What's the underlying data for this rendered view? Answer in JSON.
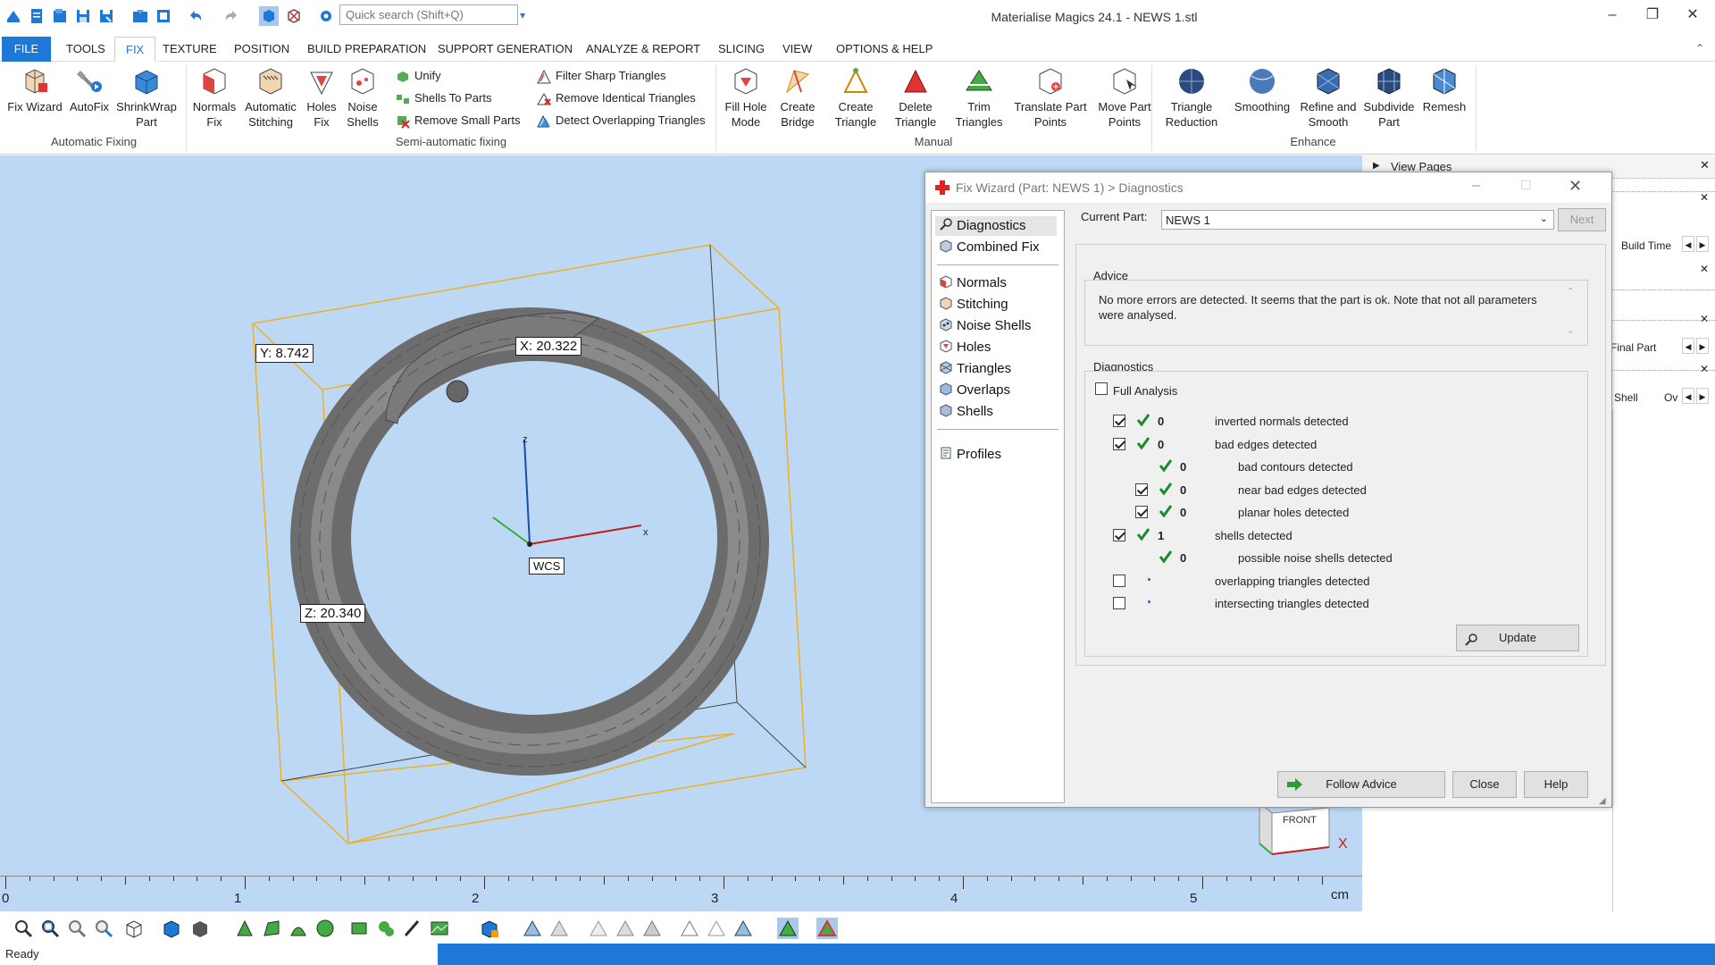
{
  "app": {
    "title": "Materialise Magics 24.1 - NEWS 1.stl",
    "search_placeholder": "Quick search (Shift+Q)"
  },
  "tabs": [
    "FILE",
    "TOOLS",
    "FIX",
    "TEXTURE",
    "POSITION",
    "BUILD PREPARATION",
    "SUPPORT GENERATION",
    "ANALYZE & REPORT",
    "SLICING",
    "VIEW",
    "OPTIONS & HELP"
  ],
  "active_tab": "FIX",
  "ribbon": {
    "automatic": {
      "group": "Automatic Fixing",
      "fix_wizard": "Fix Wizard",
      "autofix": "AutoFix",
      "shrinkwrap_1": "ShrinkWrap",
      "shrinkwrap_2": "Part"
    },
    "semi": {
      "group": "Semi-automatic fixing",
      "normals_1": "Normals",
      "normals_2": "Fix",
      "stitching_1": "Automatic",
      "stitching_2": "Stitching",
      "holes_1": "Holes",
      "holes_2": "Fix",
      "noise_1": "Noise",
      "noise_2": "Shells",
      "unify": "Unify",
      "shells_to_parts": "Shells To Parts",
      "remove_small_parts": "Remove Small Parts",
      "filter_sharp": "Filter Sharp Triangles",
      "remove_identical": "Remove Identical Triangles",
      "detect_overlapping": "Detect Overlapping Triangles"
    },
    "manual": {
      "group": "Manual",
      "fill_hole_1": "Fill Hole",
      "fill_hole_2": "Mode",
      "create_bridge_1": "Create",
      "create_bridge_2": "Bridge",
      "create_triangle_1": "Create",
      "create_triangle_2": "Triangle",
      "delete_triangle_1": "Delete",
      "delete_triangle_2": "Triangle",
      "trim_1": "Trim",
      "trim_2": "Triangles",
      "translate_1": "Translate Part",
      "translate_2": "Points",
      "move_1": "Move Part",
      "move_2": "Points"
    },
    "enhance": {
      "group": "Enhance",
      "reduction_1": "Triangle",
      "reduction_2": "Reduction",
      "smoothing": "Smoothing",
      "refine_1": "Refine and",
      "refine_2": "Smooth",
      "subdivide_1": "Subdivide",
      "subdivide_2": "Part",
      "remesh": "Remesh"
    }
  },
  "viewport": {
    "dim_y": "Y: 8.742",
    "dim_x": "X: 20.322",
    "dim_z": "Z: 20.340",
    "axis_z": "z",
    "axis_x": "x",
    "wcs": "WCS",
    "cube_face": "FRONT",
    "cube_axis": "X"
  },
  "ruler": {
    "labels": [
      "0",
      "1",
      "2",
      "3",
      "4",
      "5"
    ],
    "unit": "cm"
  },
  "right_panel": {
    "view_pages": "View Pages",
    "build_time": "Build Time",
    "final_part": "Final Part",
    "shell": "Shell",
    "ov": "Ov"
  },
  "dialog": {
    "title": "Fix Wizard (Part: NEWS 1) > Diagnostics",
    "nav": {
      "diagnostics": "Diagnostics",
      "combined_fix": "Combined Fix",
      "normals": "Normals",
      "stitching": "Stitching",
      "noise_shells": "Noise Shells",
      "holes": "Holes",
      "triangles": "Triangles",
      "overlaps": "Overlaps",
      "shells": "Shells",
      "profiles": "Profiles"
    },
    "current_part_label": "Current Part:",
    "current_part": "NEWS 1",
    "next": "Next",
    "advice_title": "Advice",
    "advice_text": "No more errors are detected. It seems that the part is ok. Note that not all parameters were analysed.",
    "diag_title": "Diagnostics",
    "full_analysis": "Full Analysis",
    "rows": [
      {
        "count": "0",
        "text": "inverted normals detected"
      },
      {
        "count": "0",
        "text": "bad edges detected"
      },
      {
        "count": "0",
        "text": "bad contours detected"
      },
      {
        "count": "0",
        "text": "near bad edges detected"
      },
      {
        "count": "0",
        "text": "planar holes detected"
      },
      {
        "count": "1",
        "text": "shells detected"
      },
      {
        "count": "0",
        "text": "possible noise shells detected"
      },
      {
        "count": "",
        "text": "overlapping triangles detected"
      },
      {
        "count": "",
        "text": "intersecting triangles detected"
      }
    ],
    "update": "Update",
    "follow_advice": "Follow Advice",
    "close": "Close",
    "help": "Help"
  },
  "status": "Ready",
  "colors": {
    "accent": "#1e78d7",
    "viewport_bg": "#bcd8f4",
    "bbox": "#f0b020",
    "check_green": "#1a8a2a"
  }
}
